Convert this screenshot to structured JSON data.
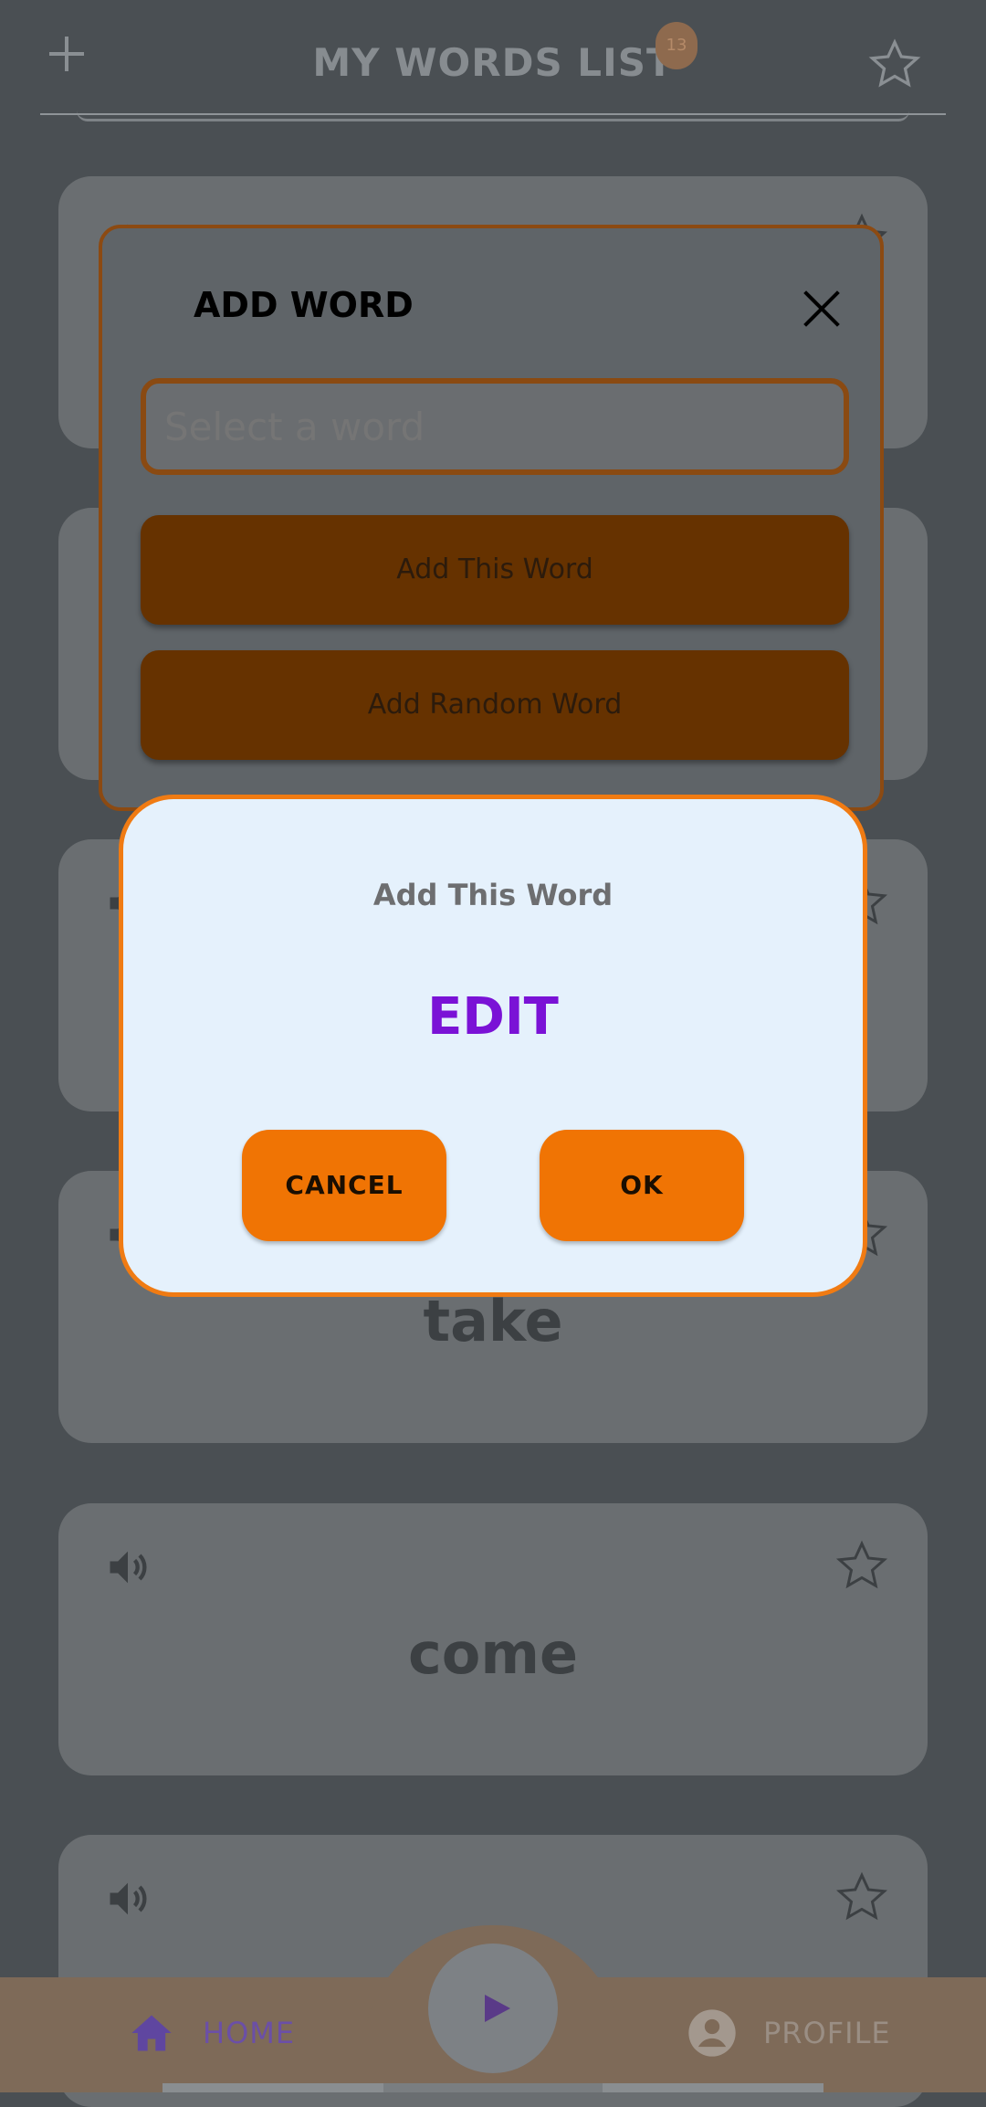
{
  "header": {
    "title": "MY WORDS LIST",
    "badge_count": "13"
  },
  "cards": [
    {
      "word": ""
    },
    {
      "word": ""
    },
    {
      "word": ""
    },
    {
      "word": "take"
    },
    {
      "word": "come"
    },
    {
      "word": ""
    }
  ],
  "add_dialog": {
    "title": "ADD WORD",
    "input_placeholder": "Select a word",
    "add_this_label": "Add This Word",
    "add_random_label": "Add Random Word"
  },
  "confirm_dialog": {
    "title": "Add This Word",
    "word": "EDIT",
    "cancel_label": "CANCEL",
    "ok_label": "OK"
  },
  "nav": {
    "home_label": "HOME",
    "profile_label": "PROFILE"
  },
  "colors": {
    "accent": "#f07404",
    "word_highlight": "#7a12d6",
    "dialog_bg": "#e5f1fc"
  }
}
